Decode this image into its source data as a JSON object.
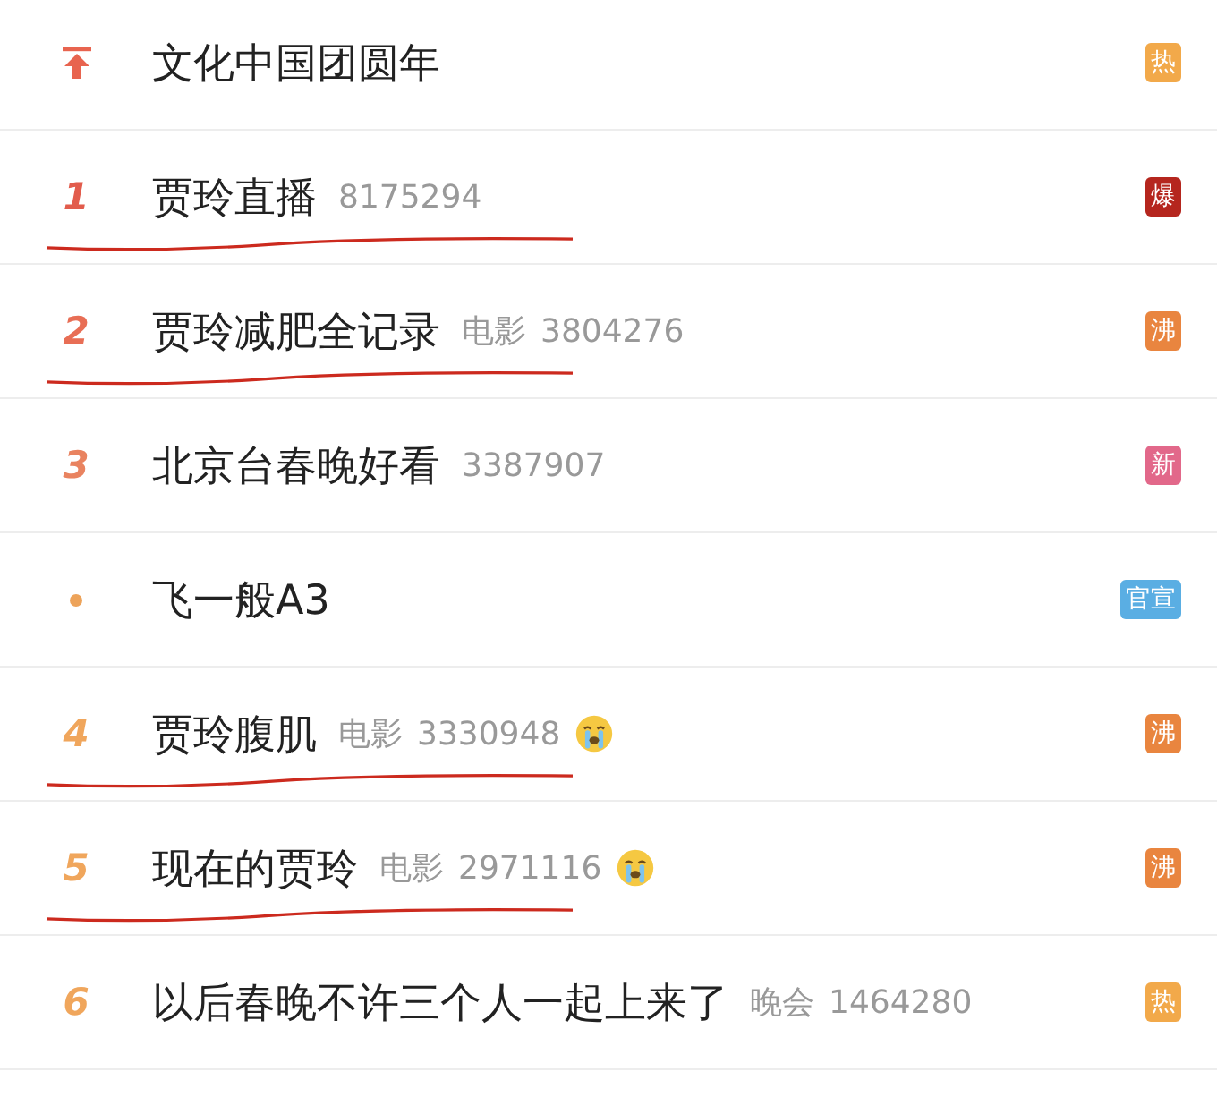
{
  "hot_search": [
    {
      "marker": {
        "kind": "pinned",
        "color": "#e8644f"
      },
      "title": "文化中国团圆年",
      "badge": {
        "text": "热",
        "color": "#f2a94a"
      },
      "underlined": false,
      "crying_emoji": false
    },
    {
      "marker": {
        "kind": "rank",
        "text": "1",
        "color": "#e25c4c"
      },
      "title": "贾玲直播",
      "count": "8175294",
      "badge": {
        "text": "爆",
        "color": "#b5261e"
      },
      "underlined": true,
      "crying_emoji": false
    },
    {
      "marker": {
        "kind": "rank",
        "text": "2",
        "color": "#e86e55"
      },
      "title": "贾玲减肥全记录",
      "category": "电影",
      "count": "3804276",
      "badge": {
        "text": "沸",
        "color": "#e9853f"
      },
      "underlined": true,
      "crying_emoji": false
    },
    {
      "marker": {
        "kind": "rank",
        "text": "3",
        "color": "#e98360"
      },
      "title": "北京台春晚好看",
      "count": "3387907",
      "badge": {
        "text": "新",
        "color": "#e2688a"
      },
      "underlined": false,
      "crying_emoji": false
    },
    {
      "marker": {
        "kind": "dot",
        "color": "#eda35a"
      },
      "title": "飞一般A3",
      "badge": {
        "text": "官宣",
        "color": "#5aaee3"
      },
      "underlined": false,
      "crying_emoji": false
    },
    {
      "marker": {
        "kind": "rank",
        "text": "4",
        "color": "#f0a65c"
      },
      "title": "贾玲腹肌",
      "category": "电影",
      "count": "3330948",
      "badge": {
        "text": "沸",
        "color": "#e9853f"
      },
      "underlined": true,
      "crying_emoji": true
    },
    {
      "marker": {
        "kind": "rank",
        "text": "5",
        "color": "#f0a65c"
      },
      "title": "现在的贾玲",
      "category": "电影",
      "count": "2971116",
      "badge": {
        "text": "沸",
        "color": "#e9853f"
      },
      "underlined": true,
      "crying_emoji": true
    },
    {
      "marker": {
        "kind": "rank",
        "text": "6",
        "color": "#f0a65c"
      },
      "title": "以后春晚不许三个人一起上来了",
      "category": "晚会",
      "count": "1464280",
      "badge": {
        "text": "热",
        "color": "#f2a94a"
      },
      "underlined": false,
      "crying_emoji": false
    }
  ]
}
